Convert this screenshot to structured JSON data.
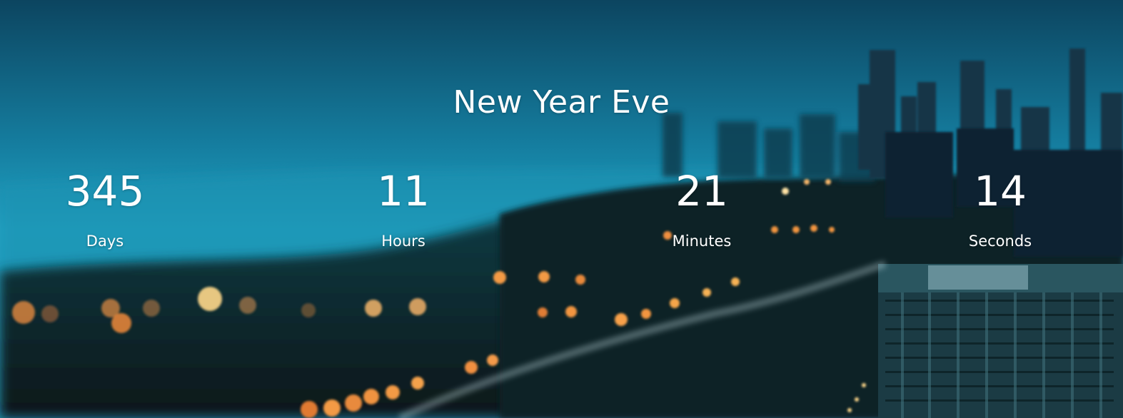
{
  "page": {
    "title": "New Year Eve"
  },
  "countdown": [
    {
      "value": "345",
      "label": "Days"
    },
    {
      "value": "11",
      "label": "Hours"
    },
    {
      "value": "21",
      "label": "Minutes"
    },
    {
      "value": "14",
      "label": "Seconds"
    }
  ],
  "colors": {
    "sky_top": "#0e4a66",
    "sky_mid": "#1b8aa8",
    "lake": "#2aa6c4",
    "land": "#0b1f22",
    "lights": "#f59a3c",
    "text": "#ffffff"
  },
  "background": {
    "scene": "blurred-city-skyline-background"
  }
}
